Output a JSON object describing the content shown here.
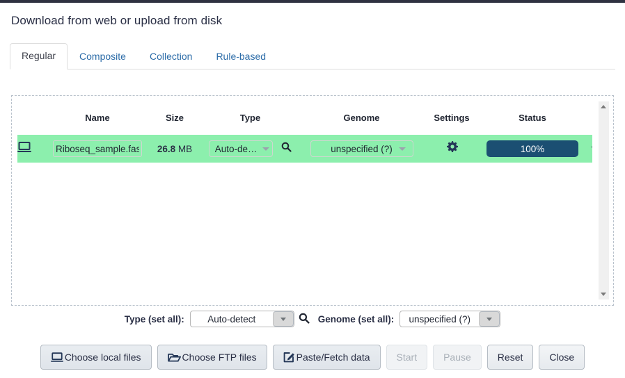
{
  "window": {
    "title": "Download from web or upload from disk"
  },
  "tabs": [
    {
      "label": "Regular",
      "active": true
    },
    {
      "label": "Composite",
      "active": false
    },
    {
      "label": "Collection",
      "active": false
    },
    {
      "label": "Rule-based",
      "active": false
    }
  ],
  "table": {
    "columns": {
      "name": "Name",
      "size": "Size",
      "type": "Type",
      "genome": "Genome",
      "settings": "Settings",
      "status": "Status"
    },
    "rows": [
      {
        "source_icon": "laptop-icon",
        "name_value": "Riboseq_sample.fastq",
        "size_number": "26.8",
        "size_unit": "MB",
        "type_value": "Auto-de…",
        "type_search_icon": "magnifier-icon",
        "genome_value": "unspecified (?)",
        "settings_icon": "gear-icon",
        "status_percent": "100%",
        "status_check_icon": "check-icon"
      }
    ]
  },
  "scrollbar": {
    "up_icon": "chevron-up-icon",
    "down_icon": "chevron-down-icon"
  },
  "set_all": {
    "type_label": "Type (set all):",
    "type_value": "Auto-detect",
    "type_search_icon": "magnifier-icon",
    "genome_label": "Genome (set all):",
    "genome_value": "unspecified (?)"
  },
  "buttons": {
    "choose_local": "Choose local files",
    "choose_local_icon": "laptop-icon",
    "choose_ftp": "Choose FTP files",
    "choose_ftp_icon": "folder-open-icon",
    "paste_fetch": "Paste/Fetch data",
    "paste_fetch_icon": "pencil-square-icon",
    "start": "Start",
    "pause": "Pause",
    "reset": "Reset",
    "close": "Close"
  },
  "colors": {
    "row_green": "#8cefad",
    "progress_navy": "#1b4f72",
    "tab_link_blue": "#2c6ca8",
    "dashed_border": "#b9c2cc"
  }
}
